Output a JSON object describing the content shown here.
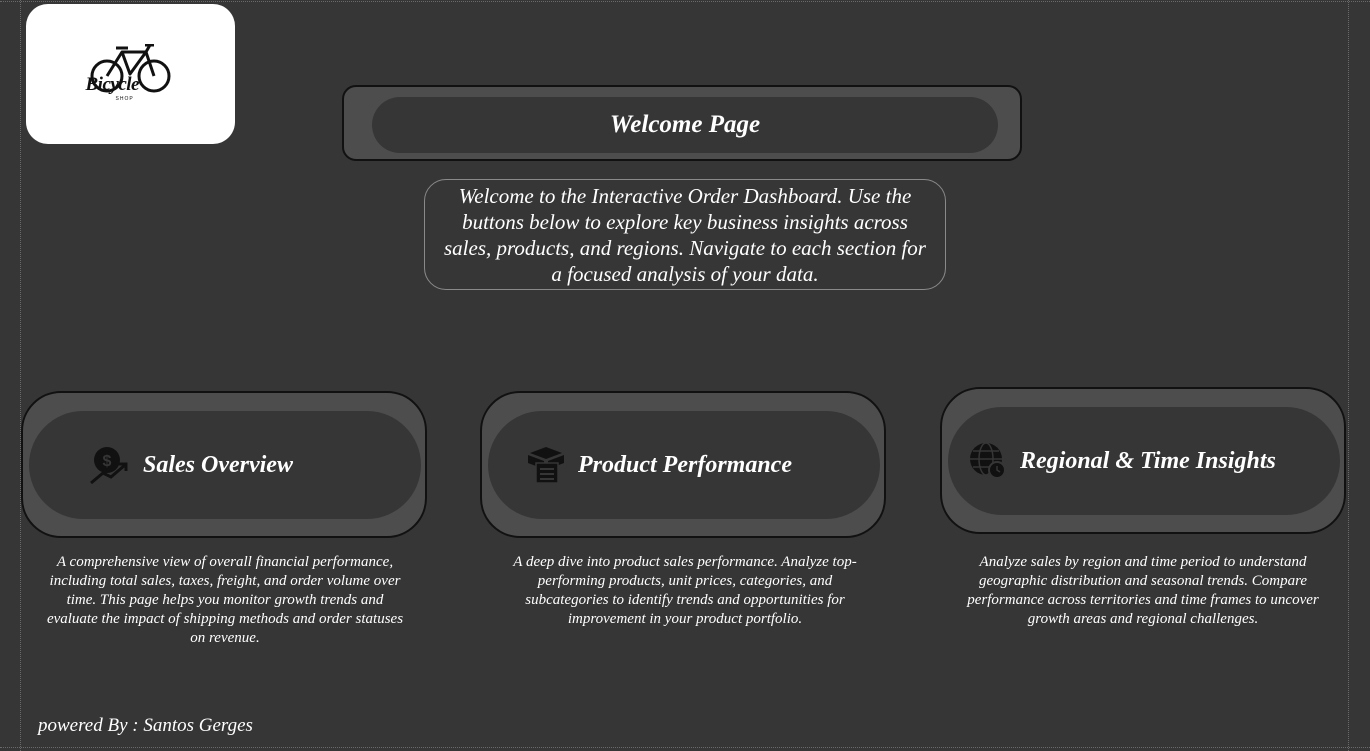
{
  "logo": {
    "brand_text": "Bicycle",
    "sub_text": "SHOP",
    "icon": "bicycle-icon"
  },
  "header": {
    "title": "Welcome Page"
  },
  "intro": {
    "text": "Welcome to the Interactive Order Dashboard. Use the buttons below to explore key business insights across sales, products, and regions. Navigate to each section for a focused analysis of your data."
  },
  "nav": [
    {
      "label": "Sales Overview",
      "icon": "money-growth-icon",
      "description": "A comprehensive view of overall financial performance, including total sales, taxes, freight, and order volume over time. This page helps you monitor growth trends and evaluate the impact of shipping methods and order statuses on revenue."
    },
    {
      "label": "Product Performance",
      "icon": "product-box-icon",
      "description": "A deep dive into product sales performance. Analyze top-performing products, unit prices, categories, and subcategories to identify trends and opportunities for improvement in your product portfolio."
    },
    {
      "label": "Regional & Time Insights",
      "icon": "globe-clock-icon",
      "description": "Analyze sales by region and time period to understand geographic distribution and seasonal trends. Compare performance across territories and time frames to uncover growth areas and regional challenges."
    }
  ],
  "footer": {
    "text": "powered By : Santos Gerges"
  },
  "colors": {
    "background": "#363636",
    "card_outer": "#4d4d4d",
    "text": "#ffffff"
  }
}
